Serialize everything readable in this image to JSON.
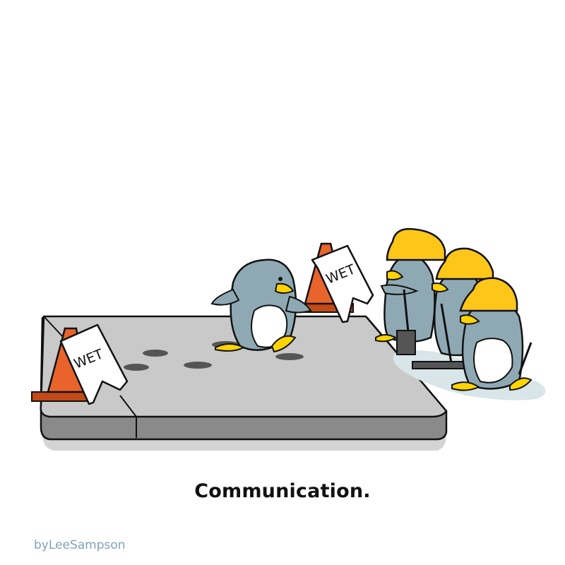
{
  "caption": "Communication.",
  "signature": "byLeeSampson",
  "signs": [
    "WET",
    "WET"
  ],
  "colors": {
    "sidewalk_top": "#c9c9c9",
    "sidewalk_side": "#8a8a8a",
    "sidewalk_shadow": "#d4d4d4",
    "penguin_body": "#8fa9b4",
    "penguin_belly": "#ffffff",
    "beak_feet": "#ffd400",
    "hard_hat": "#ffc61a",
    "cone": "#e8642a",
    "puddle": "#d8e6ea",
    "signature": "#7fa3b8"
  }
}
